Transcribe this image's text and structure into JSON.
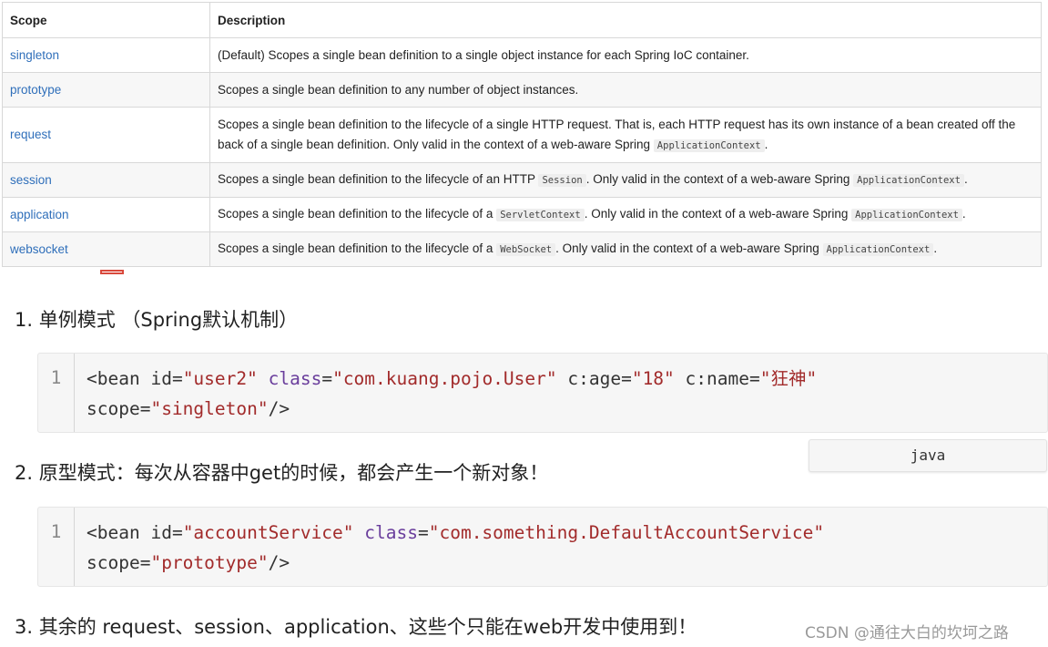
{
  "table": {
    "headers": [
      "Scope",
      "Description"
    ],
    "rows": [
      {
        "scope": "singleton",
        "desc": [
          "(Default) Scopes a single bean definition to a single object instance for each Spring IoC container."
        ]
      },
      {
        "scope": "prototype",
        "desc": [
          "Scopes a single bean definition to any number of object instances."
        ]
      },
      {
        "scope": "request",
        "desc": [
          "Scopes a single bean definition to the lifecycle of a single HTTP request. That is, each HTTP request has its own instance of a bean created off the back of a single bean definition. Only valid in the context of a web-aware Spring ",
          {
            "code": "ApplicationContext"
          },
          "."
        ]
      },
      {
        "scope": "session",
        "desc": [
          "Scopes a single bean definition to the lifecycle of an HTTP ",
          {
            "code": "Session"
          },
          ". Only valid in the context of a web-aware Spring ",
          {
            "code": "ApplicationContext"
          },
          "."
        ]
      },
      {
        "scope": "application",
        "desc": [
          "Scopes a single bean definition to the lifecycle of a ",
          {
            "code": "ServletContext"
          },
          ". Only valid in the context of a web-aware Spring ",
          {
            "code": "ApplicationContext"
          },
          "."
        ]
      },
      {
        "scope": "websocket",
        "desc": [
          "Scopes a single bean definition to the lifecycle of a ",
          {
            "code": "WebSocket"
          },
          ". Only valid in the context of a web-aware Spring ",
          {
            "code": "ApplicationContext"
          },
          "."
        ]
      }
    ]
  },
  "headings": {
    "h1": "1. 单例模式 （Spring默认机制）",
    "h2": "2. 原型模式：每次从容器中get的时候，都会产生一个新对象！",
    "h3": "3. 其余的 request、session、application、这些个只能在web开发中使用到！"
  },
  "code1": {
    "line_number": "1",
    "lines": [
      [
        [
          "tag",
          "<bean "
        ],
        [
          "attr",
          "id"
        ],
        [
          "tag",
          "="
        ],
        [
          "str",
          "\"user2\""
        ],
        [
          "tag",
          " "
        ],
        [
          "attr2",
          "class"
        ],
        [
          "tag",
          "="
        ],
        [
          "str",
          "\"com.kuang.pojo.User\""
        ],
        [
          "tag",
          " "
        ],
        [
          "attr",
          "c:age"
        ],
        [
          "tag",
          "="
        ],
        [
          "str",
          "\"18\""
        ],
        [
          "tag",
          " "
        ],
        [
          "attr",
          "c:name"
        ],
        [
          "tag",
          "="
        ],
        [
          "str",
          "\"狂神\""
        ]
      ],
      [
        [
          "attr",
          "scope"
        ],
        [
          "tag",
          "="
        ],
        [
          "str",
          "\"singleton\""
        ],
        [
          "tag",
          "/>"
        ]
      ]
    ]
  },
  "code2": {
    "line_number": "1",
    "lines": [
      [
        [
          "tag",
          "<bean "
        ],
        [
          "attr",
          "id"
        ],
        [
          "tag",
          "="
        ],
        [
          "str",
          "\"accountService\""
        ],
        [
          "tag",
          " "
        ],
        [
          "attr2",
          "class"
        ],
        [
          "tag",
          "="
        ],
        [
          "str",
          "\"com.something.DefaultAccountService\""
        ]
      ],
      [
        [
          "attr",
          "scope"
        ],
        [
          "tag",
          "="
        ],
        [
          "str",
          "\"prototype\""
        ],
        [
          "tag",
          "/>"
        ]
      ]
    ]
  },
  "lang_badge": "java",
  "watermark": "CSDN @通往大白的坎坷之路",
  "colors": {
    "scope_link": "#2f6fba",
    "code_string": "#a22b2b",
    "code_keyword_class": "#6a3e9c",
    "marker_red": "#d9493c"
  }
}
